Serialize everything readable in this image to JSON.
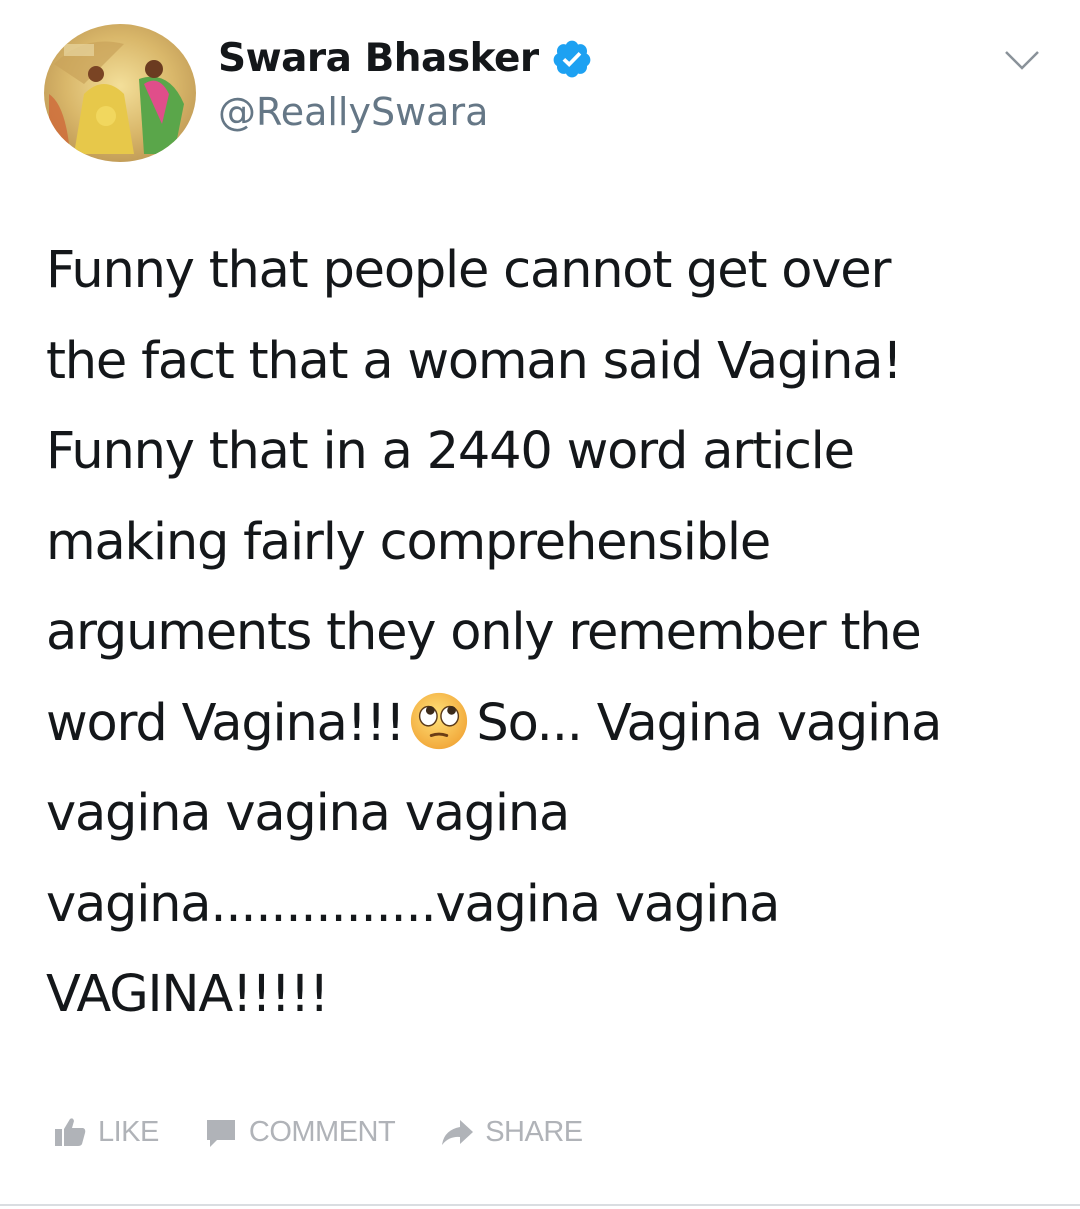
{
  "tweet": {
    "author": {
      "display_name": "Swara Bhasker",
      "handle": "@ReallySwara",
      "verified": true
    },
    "text_lines": [
      "Funny that people cannot get over",
      "the fact that a woman said Vagina!",
      "Funny that in a 2440 word article",
      "making fairly comprehensible",
      "arguments they only remember the",
      "word Vagina!!!",
      "So... Vagina vagina",
      "vagina vagina vagina",
      "vagina...............vagina vagina",
      "VAGINA!!!!!"
    ],
    "emoji": "face-with-rolling-eyes"
  },
  "actions": {
    "like": "LIKE",
    "comment": "COMMENT",
    "share": "SHARE"
  },
  "icons": {
    "verified": "verified-badge-icon",
    "chevron": "chevron-down-icon",
    "like": "thumbs-up-icon",
    "comment": "comment-bubble-icon",
    "share": "share-arrow-icon"
  },
  "colors": {
    "text": "#14171a",
    "handle": "#657786",
    "verified_badge": "#1da1f2",
    "action_label": "#b0b3b8"
  }
}
